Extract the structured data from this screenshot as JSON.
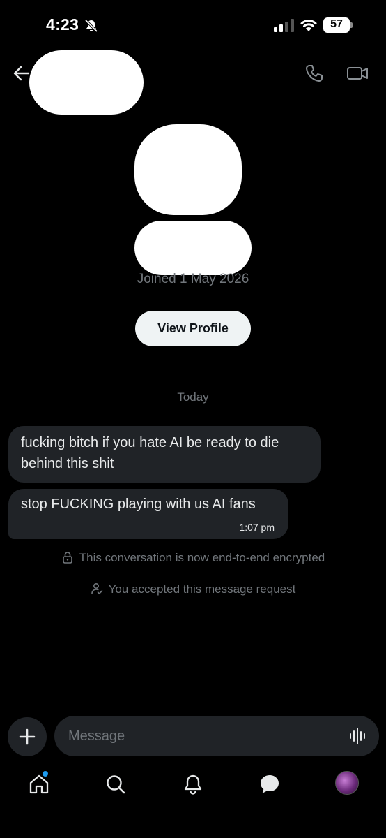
{
  "status_bar": {
    "time": "4:23",
    "battery": "57"
  },
  "header": {
    "back_icon": "arrow-left-icon",
    "call_icon": "phone-icon",
    "video_icon": "video-camera-icon"
  },
  "profile": {
    "joined": "Joined 1 May 2026",
    "view_profile_label": "View Profile"
  },
  "conversation": {
    "day_separator": "Today",
    "messages": [
      {
        "text": "fucking bitch if you hate AI be ready to die behind this shit",
        "time": ""
      },
      {
        "text": "stop FUCKING playing with us AI fans",
        "time": "1:07 pm"
      }
    ],
    "system": {
      "encrypted": "This conversation is now end-to-end encrypted",
      "accepted": "You accepted this message request"
    }
  },
  "composer": {
    "placeholder": "Message"
  },
  "nav": {
    "items": [
      "home-icon",
      "search-icon",
      "notifications-icon",
      "messages-icon",
      "profile-avatar"
    ]
  },
  "colors": {
    "background": "#000000",
    "bubble": "#202327",
    "muted_text": "#71767b",
    "accent": "#1d9bf0"
  }
}
